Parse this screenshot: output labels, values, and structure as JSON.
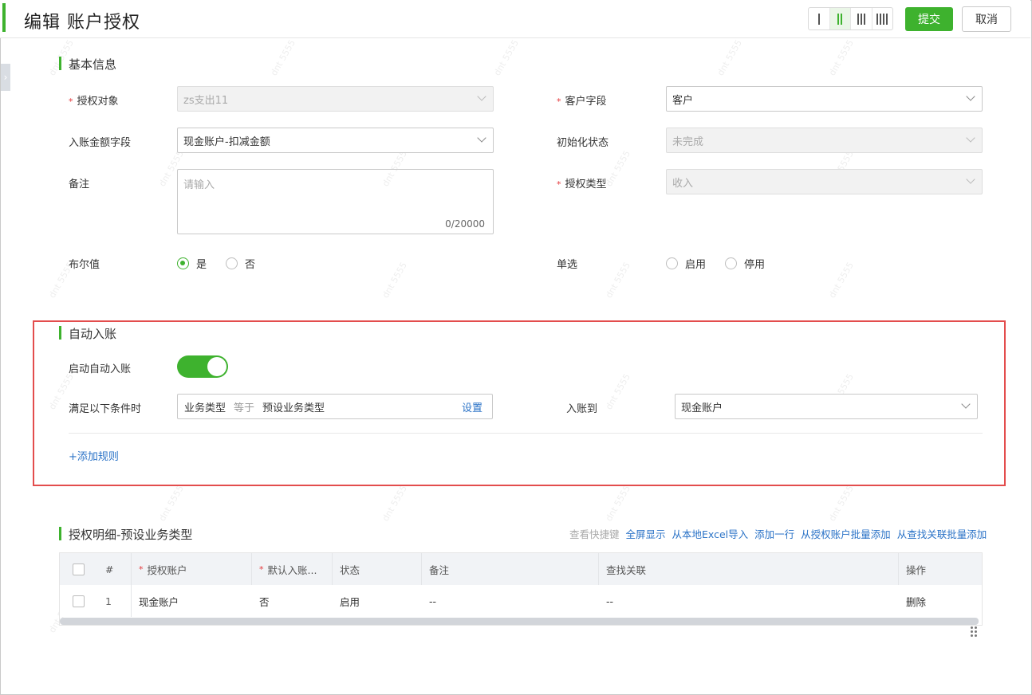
{
  "header": {
    "title": "编辑 账户授权",
    "submit_label": "提交",
    "cancel_label": "取消",
    "layout_options": [
      1,
      2,
      3,
      4
    ],
    "layout_active": 2
  },
  "basic": {
    "section_title": "基本信息",
    "auth_object": {
      "label": "授权对象",
      "value": "zs支出11"
    },
    "customer_field": {
      "label": "客户字段",
      "value": "客户"
    },
    "amount_field": {
      "label": "入账金额字段",
      "value": "现金账户-扣减金额"
    },
    "init_status": {
      "label": "初始化状态",
      "value": "未完成"
    },
    "remark": {
      "label": "备注",
      "placeholder": "请输入",
      "counter": "0/20000"
    },
    "auth_type": {
      "label": "授权类型",
      "value": "收入"
    },
    "bool_field": {
      "label": "布尔值",
      "options": [
        "是",
        "否"
      ],
      "selected": "是"
    },
    "single_select": {
      "label": "单选",
      "options": [
        "启用",
        "停用"
      ],
      "selected": ""
    }
  },
  "auto": {
    "section_title": "自动入账",
    "enable_label": "启动自动入账",
    "enabled": true,
    "condition_label": "满足以下条件时",
    "condition": {
      "field": "业务类型",
      "operator": "等于",
      "value": "预设业务类型",
      "set_label": "设置"
    },
    "target_label": "入账到",
    "target_value": "现金账户",
    "add_rule": "+添加规则"
  },
  "detail": {
    "section_title": "授权明细-预设业务类型",
    "actions": [
      "查看快捷键",
      "全屏显示",
      "从本地Excel导入",
      "添加一行",
      "从授权账户批量添加",
      "从查找关联批量添加"
    ],
    "columns": [
      "#",
      "授权账户",
      "默认入账...",
      "状态",
      "备注",
      "查找关联",
      "操作"
    ],
    "rows": [
      {
        "index": "1",
        "account": "现金账户",
        "default": "否",
        "status": "启用",
        "remark": "--",
        "lookup": "--",
        "action": "删除"
      }
    ]
  },
  "colors": {
    "accent": "#3eb22e",
    "link": "#2b73c7",
    "required": "#e4393c",
    "highlight": "#e34d4d"
  }
}
